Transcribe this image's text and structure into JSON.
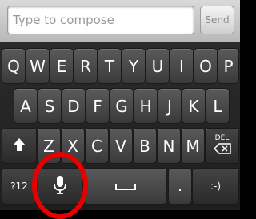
{
  "compose": {
    "placeholder": "Type to compose",
    "value": "",
    "send_label": "Send"
  },
  "keyboard": {
    "row1": [
      "Q",
      "W",
      "E",
      "R",
      "T",
      "Y",
      "U",
      "I",
      "O",
      "P"
    ],
    "row2": [
      "A",
      "S",
      "D",
      "F",
      "G",
      "H",
      "J",
      "K",
      "L"
    ],
    "row3": [
      "Z",
      "X",
      "C",
      "V",
      "B",
      "N",
      "M"
    ],
    "delete_label": "DEL",
    "symbols_label": "?12",
    "period_label": ".",
    "emoticon_label": ":-)"
  },
  "icons": {
    "shift": "shift-arrow-icon",
    "delete": "backspace-icon",
    "mic": "microphone-icon",
    "space": "space-bar-icon"
  },
  "colors": {
    "highlight_ring": "#e60000"
  }
}
